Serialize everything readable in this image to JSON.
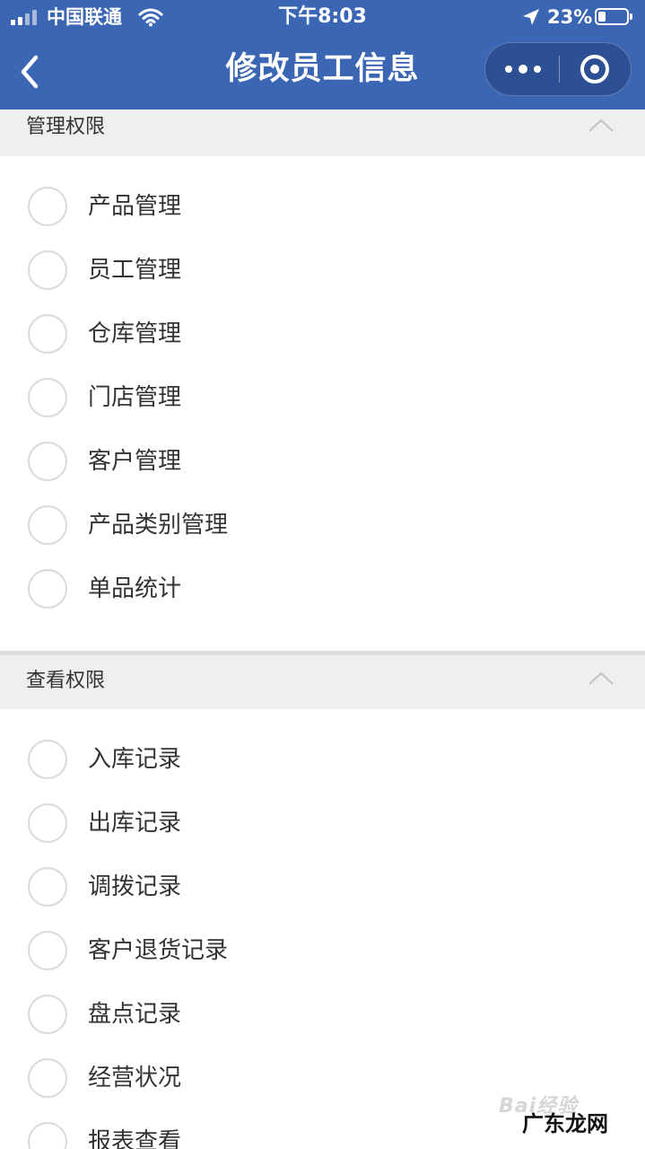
{
  "status_bar": {
    "carrier": "中国联通",
    "time": "下午8:03",
    "battery": "23%",
    "icons": [
      "signal-icon",
      "wifi-icon",
      "location-arrow-icon",
      "battery-icon"
    ]
  },
  "nav": {
    "title": "修改员工信息",
    "icons": [
      "back-chevron-icon",
      "more-dots-icon",
      "close-target-icon"
    ]
  },
  "sections": [
    {
      "title": "管理权限",
      "items": [
        "产品管理",
        "员工管理",
        "仓库管理",
        "门店管理",
        "客户管理",
        "产品类别管理",
        "单品统计"
      ]
    },
    {
      "title": "查看权限",
      "items": [
        "入库记录",
        "出库记录",
        "调拨记录",
        "客户退货记录",
        "盘点记录",
        "经营状况",
        "报表查看"
      ]
    }
  ],
  "watermark": {
    "baidu": "Bai经验",
    "site": "广东龙网"
  },
  "colors": {
    "header_bg": "#3a66b3",
    "section_bg": "#efefef",
    "radio_border": "#d9d9d9",
    "text": "#333333"
  }
}
